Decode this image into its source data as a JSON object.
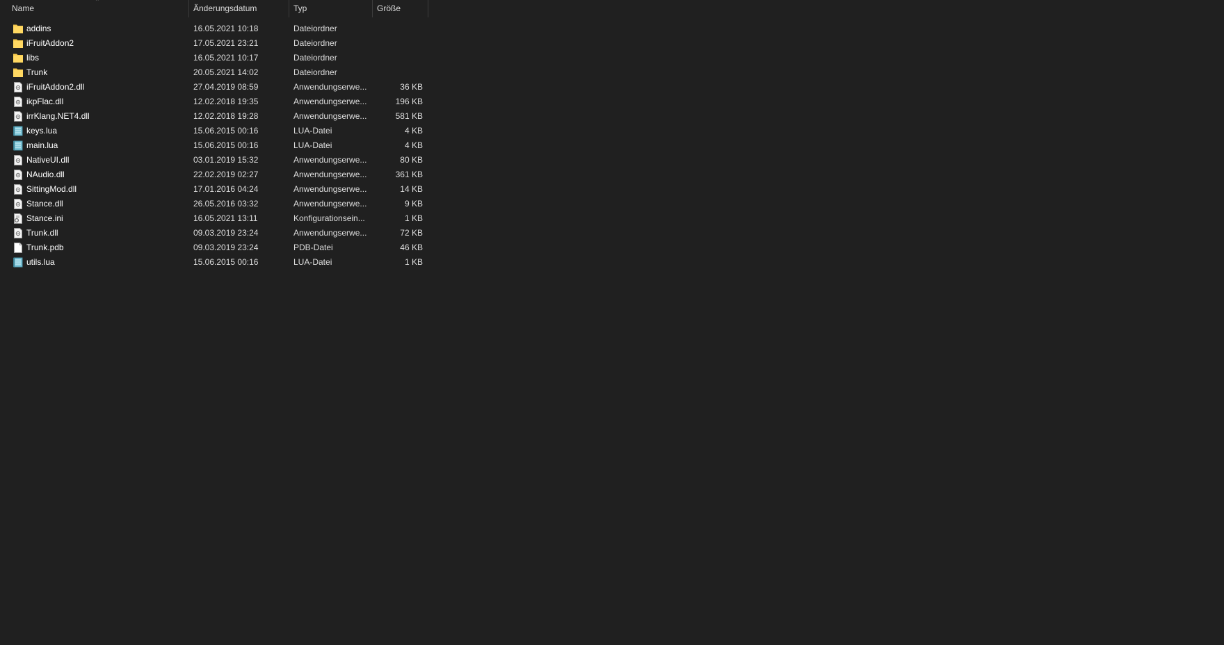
{
  "columns": {
    "name": "Name",
    "date": "Änderungsdatum",
    "type": "Typ",
    "size": "Größe"
  },
  "sort": {
    "column": "name",
    "direction": "ascending",
    "icon": "sort-up-caret-icon"
  },
  "files": [
    {
      "name": "addins",
      "date": "16.05.2021 10:18",
      "type": "Dateiordner",
      "size": "",
      "icon": "folder-icon"
    },
    {
      "name": "iFruitAddon2",
      "date": "17.05.2021 23:21",
      "type": "Dateiordner",
      "size": "",
      "icon": "folder-icon"
    },
    {
      "name": "libs",
      "date": "16.05.2021 10:17",
      "type": "Dateiordner",
      "size": "",
      "icon": "folder-icon"
    },
    {
      "name": "Trunk",
      "date": "20.05.2021 14:02",
      "type": "Dateiordner",
      "size": "",
      "icon": "folder-icon"
    },
    {
      "name": "iFruitAddon2.dll",
      "date": "27.04.2019 08:59",
      "type": "Anwendungserwe...",
      "size": "36 KB",
      "icon": "dll-file-icon"
    },
    {
      "name": "ikpFlac.dll",
      "date": "12.02.2018 19:35",
      "type": "Anwendungserwe...",
      "size": "196 KB",
      "icon": "dll-file-icon"
    },
    {
      "name": "irrKlang.NET4.dll",
      "date": "12.02.2018 19:28",
      "type": "Anwendungserwe...",
      "size": "581 KB",
      "icon": "dll-file-icon"
    },
    {
      "name": "keys.lua",
      "date": "15.06.2015 00:16",
      "type": "LUA-Datei",
      "size": "4 KB",
      "icon": "lua-file-icon"
    },
    {
      "name": "main.lua",
      "date": "15.06.2015 00:16",
      "type": "LUA-Datei",
      "size": "4 KB",
      "icon": "lua-file-icon"
    },
    {
      "name": "NativeUI.dll",
      "date": "03.01.2019 15:32",
      "type": "Anwendungserwe...",
      "size": "80 KB",
      "icon": "dll-file-icon"
    },
    {
      "name": "NAudio.dll",
      "date": "22.02.2019 02:27",
      "type": "Anwendungserwe...",
      "size": "361 KB",
      "icon": "dll-file-icon"
    },
    {
      "name": "SittingMod.dll",
      "date": "17.01.2016 04:24",
      "type": "Anwendungserwe...",
      "size": "14 KB",
      "icon": "dll-file-icon"
    },
    {
      "name": "Stance.dll",
      "date": "26.05.2016 03:32",
      "type": "Anwendungserwe...",
      "size": "9 KB",
      "icon": "dll-file-icon"
    },
    {
      "name": "Stance.ini",
      "date": "16.05.2021 13:11",
      "type": "Konfigurationsein...",
      "size": "1 KB",
      "icon": "ini-file-icon"
    },
    {
      "name": "Trunk.dll",
      "date": "09.03.2019 23:24",
      "type": "Anwendungserwe...",
      "size": "72 KB",
      "icon": "dll-file-icon"
    },
    {
      "name": "Trunk.pdb",
      "date": "09.03.2019 23:24",
      "type": "PDB-Datei",
      "size": "46 KB",
      "icon": "blank-file-icon"
    },
    {
      "name": "utils.lua",
      "date": "15.06.2015 00:16",
      "type": "LUA-Datei",
      "size": "1 KB",
      "icon": "lua-file-icon"
    }
  ],
  "colors": {
    "background": "#202020",
    "folder": "#f5c84c",
    "text": "#ffffff"
  }
}
